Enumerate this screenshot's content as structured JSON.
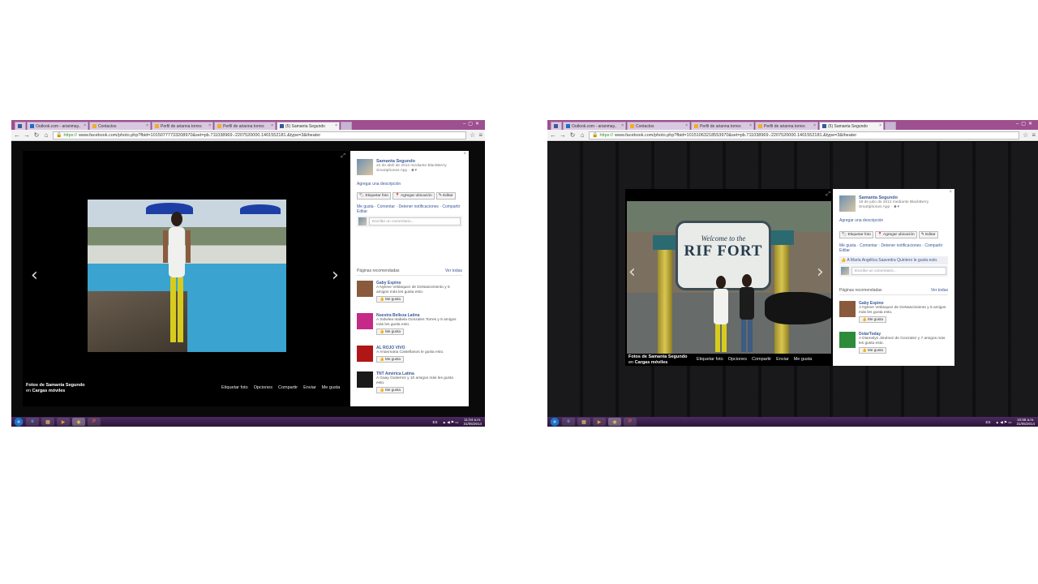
{
  "screens": [
    {
      "tabs": [
        {
          "label": "",
          "icon": "facebook-icon"
        },
        {
          "label": "Outlook.com - arianmay..",
          "icon": "outlook-icon"
        },
        {
          "label": "Contactos",
          "icon": "contacts-icon"
        },
        {
          "label": "Perfil de arianna torres",
          "icon": "windows-icon"
        },
        {
          "label": "Perfil de arianna torres",
          "icon": "windows-icon"
        },
        {
          "label": "(5) Samanta Segundo",
          "icon": "facebook-icon",
          "active": true
        }
      ],
      "url_scheme": "https://",
      "url_rest": "www.facebook.com/photo.php?fbid=10150777733208970&set=pb.711038969.-2207520000.1401552181.&type=3&theater",
      "caption_prefix": "Fotos de Samanta Segundo",
      "caption_in": "en",
      "caption_album": "Cargas móviles",
      "actions": [
        "Etiquetar foto",
        "Opciones",
        "Compartir",
        "Enviar",
        "Me gusta"
      ],
      "sidebar": {
        "name": "Samanta Segundo",
        "date_line": "22 de abril de 2012 mediante BlackBerry",
        "app_line": "Smartphones App ·",
        "add_description": "Agregar una descripción",
        "buttons": [
          "Etiquetar foto",
          "Agregar ubicación",
          "Editar"
        ],
        "links": [
          "Me gusta",
          "Comentar",
          "Detener notificaciones",
          "Compartir",
          "Editar"
        ],
        "likes_line": "",
        "comment_placeholder": "Escribe un comentario...",
        "rec_title": "Páginas recomendadas",
        "rec_see_all": "Ver todas",
        "rec_like": "Me gusta",
        "recommended": [
          {
            "name": "Gaby Espino",
            "desc": "A Nyleve Velásquez de DoNascimiento y 5 amigos más les gusta esto.",
            "color": "#8a5a3c"
          },
          {
            "name": "Nuestra Belleza Latina",
            "desc": "A Sidwlea Isabela Gonzales Torres y 8 amigos más les gusta esto.",
            "color": "#c42a86"
          },
          {
            "name": "AL ROJO VIVO",
            "desc": "A Arianmaria Castellanos le gusta esto.",
            "color": "#b01616"
          },
          {
            "name": "TNT América Latina",
            "desc": "A Gaay Gutierrez y 10 amigos más les gusta esto.",
            "color": "#1a1a1a"
          }
        ]
      },
      "clock_time": "11:04 a.m.",
      "clock_date": "31/05/2014",
      "lang": "ES"
    },
    {
      "tabs": [
        {
          "label": "",
          "icon": "facebook-icon"
        },
        {
          "label": "Outlook.com - arianmay..",
          "icon": "outlook-icon"
        },
        {
          "label": "Contactos",
          "icon": "contacts-icon"
        },
        {
          "label": "Perfil de arianna torres",
          "icon": "windows-icon"
        },
        {
          "label": "Perfil de arianna torres",
          "icon": "windows-icon"
        },
        {
          "label": "(5) Samanta Segundo",
          "icon": "facebook-icon",
          "active": true
        }
      ],
      "url_scheme": "https://",
      "url_rest": "www.facebook.com/photo.php?fbid=10151063218553970&set=pb.711038969.-2207520000.1401552181.&type=3&theater",
      "caption_prefix": "Fotos de Samanta Segundo",
      "caption_in": "en",
      "caption_album": "Cargas móviles",
      "actions": [
        "Etiquetar foto",
        "Opciones",
        "Compartir",
        "Enviar",
        "Me gusta"
      ],
      "sidebar": {
        "name": "Samanta Segundo",
        "date_line": "18 de julio de 2012 mediante BlackBerry",
        "app_line": "Smartphones App ·",
        "add_description": "Agregar una descripción",
        "buttons": [
          "Etiquetar foto",
          "Agregar ubicación",
          "Editar"
        ],
        "links": [
          "Me gusta",
          "Comentar",
          "Detener notificaciones",
          "Compartir",
          "Editar"
        ],
        "likes_line": "A María Angélica Saavedra Quintero le gusta esto.",
        "comment_placeholder": "Escribe un comentario...",
        "rec_title": "Páginas recomendadas",
        "rec_see_all": "Ver todas",
        "rec_like": "Me gusta",
        "recommended": [
          {
            "name": "Gaby Espino",
            "desc": "A Nyleve Velásquez de DoNascimiento y 5 amigos más les gusta esto.",
            "color": "#8a5a3c"
          },
          {
            "name": "DolarToday",
            "desc": "A Diamelys Jiménez de Gonzalez y 7 amigos más les gusta esto.",
            "color": "#2e8b3a"
          }
        ]
      },
      "photo_sign": {
        "line1": "Welcome to the",
        "line2": "RIF FORT"
      },
      "clock_time": "10:58 a.m.",
      "clock_date": "31/05/2014",
      "lang": "ES"
    }
  ]
}
